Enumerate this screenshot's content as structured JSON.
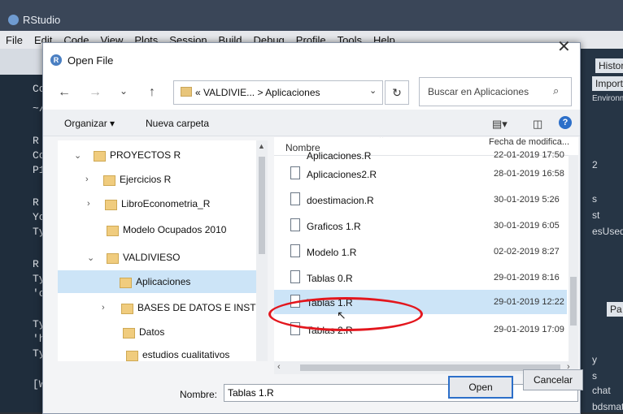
{
  "rstudio": {
    "title": "RStudio",
    "menu": [
      "File",
      "Edit",
      "Code",
      "View",
      "Plots",
      "Session",
      "Build",
      "Debug",
      "Profile",
      "Tools",
      "Help"
    ],
    "right_tabs": {
      "history": "History",
      "import": "Import",
      "environment": "Environment"
    },
    "right_snippets": [
      "2",
      "s",
      "st",
      "esUsed",
      "Pa",
      "y",
      "s",
      "chat",
      "bdsmatrix"
    ],
    "left_snippets": [
      "Co",
      "~/",
      "R",
      "Co",
      "P1",
      "R",
      "Yo",
      "Ty",
      "R",
      "Ty",
      "'c",
      "Ty",
      "'h",
      "Ty",
      "[W"
    ]
  },
  "dialog": {
    "title": "Open File",
    "address": {
      "text": "«  VALDIVIE...  >  Aplicaciones"
    },
    "search_placeholder": "Buscar en Aplicaciones",
    "toolbar": {
      "organize": "Organizar ▾",
      "new_folder": "Nueva carpeta"
    },
    "tree": [
      {
        "label": "PROYECTOS R",
        "chevron": "⌄"
      },
      {
        "label": "Ejercicios R",
        "chevron": "›"
      },
      {
        "label": "LibroEconometria_R",
        "chevron": "›"
      },
      {
        "label": "Modelo Ocupados 2010",
        "chevron": ""
      },
      {
        "label": "VALDIVIESO",
        "chevron": "⌄"
      },
      {
        "label": "Aplicaciones",
        "chevron": "",
        "selected": true
      },
      {
        "label": "BASES DE DATOS E INSTRUCT",
        "chevron": "›"
      },
      {
        "label": "Datos",
        "chevron": ""
      },
      {
        "label": "estudios cualitativos",
        "chevron": ""
      }
    ],
    "columns": {
      "name": "Nombre",
      "date": "Fecha de modifica..."
    },
    "files": [
      {
        "name": "Aplicaciones.R",
        "date": "22-01-2019 17:50"
      },
      {
        "name": "Aplicaciones2.R",
        "date": "28-01-2019 16:58"
      },
      {
        "name": "doestimacion.R",
        "date": "30-01-2019 5:26"
      },
      {
        "name": "Graficos 1.R",
        "date": "30-01-2019 6:05"
      },
      {
        "name": "Modelo 1.R",
        "date": "02-02-2019 8:27"
      },
      {
        "name": "Tablas 0.R",
        "date": "29-01-2019 8:16"
      },
      {
        "name": "Tablas 1.R",
        "date": "29-01-2019 12:22",
        "selected": true
      },
      {
        "name": "Tablas 2.R",
        "date": "29-01-2019 17:09"
      }
    ],
    "filename_label": "Nombre:",
    "filename_value": "Tablas 1.R",
    "open_button": "Open",
    "cancel_button": "Cancelar"
  }
}
